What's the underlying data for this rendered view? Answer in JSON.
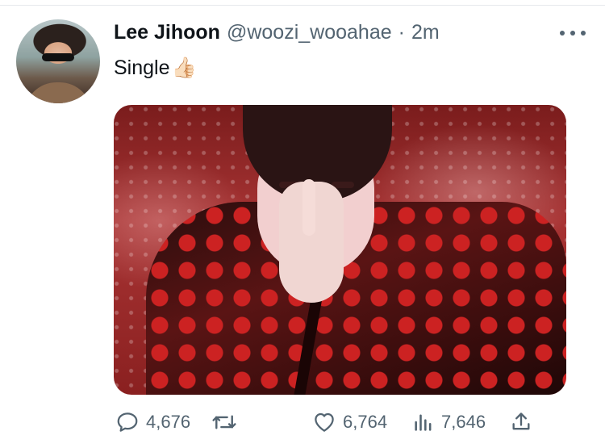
{
  "tweet": {
    "author_name": "Lee Jihoon",
    "author_handle": "@woozi_wooahae",
    "separator": "·",
    "timestamp": "2m",
    "text": "Single",
    "text_emoji": "👍🏻"
  },
  "actions": {
    "reply_count": "4,676",
    "like_count": "6,764",
    "views_count": "7,646"
  },
  "icons": {
    "more": "more-options-icon",
    "reply": "reply-icon",
    "retweet": "retweet-icon",
    "like": "heart-icon",
    "views": "views-icon",
    "share": "share-icon"
  },
  "colors": {
    "text_primary": "#0f1419",
    "text_secondary": "#536471"
  }
}
